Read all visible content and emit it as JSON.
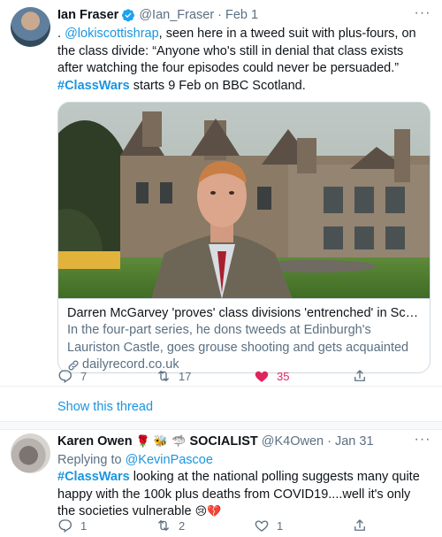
{
  "tweet1": {
    "name": "Ian Fraser",
    "handle": "@Ian_Fraser",
    "dot": "·",
    "date": "Feb 1",
    "text_prefix": ". ",
    "mention": "@lokiscottishrap",
    "text_mid": ", seen here in a tweed suit with plus-fours, on the class divide: “Anyone who's still in denial that class exists after watching the four episodes could never be persuaded.”  ",
    "hashtag": "#ClassWars",
    "text_suffix": " starts 9 Feb on BBC Scotland.",
    "card": {
      "title": "Darren McGarvey 'proves' class divisions 'entrenched' in Scotland' ...",
      "description": "In the four-part series, he dons tweeds at Edinburgh's Lauriston Castle, goes grouse shooting and gets acquainted with cricket and ...",
      "domain": "dailyrecord.co.uk"
    },
    "actions": {
      "replies": "7",
      "retweets": "17",
      "likes": "35"
    },
    "show_thread": "Show this thread"
  },
  "tweet2": {
    "name": "Karen Owen",
    "name_emojis": "🌹 🐝 🦈",
    "name_suffix": "SOCIALIST",
    "handle": "@K4Owen",
    "dot": "·",
    "date": "Jan 31",
    "replying_label": "Replying to ",
    "replying_to": "@KevinPascoe",
    "hashtag": "#ClassWars",
    "text": " looking at the national polling suggests many quite happy with the 100k plus deaths from COVID19....well it's only the societies vulnerable ",
    "text_emojis": "😢💔",
    "actions": {
      "replies": "1",
      "retweets": "2",
      "likes": "1"
    }
  },
  "colors": {
    "link": "#1b95e0",
    "muted": "#5b7083",
    "like": "#e0245e",
    "border": "#cfd9de"
  },
  "icons": [
    "more-icon",
    "verified-icon",
    "reply-icon",
    "retweet-icon",
    "like-icon",
    "share-icon",
    "link-icon"
  ]
}
